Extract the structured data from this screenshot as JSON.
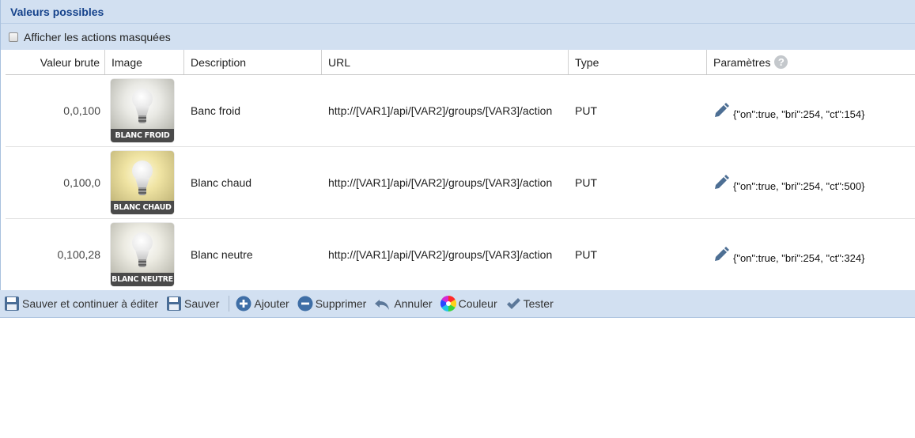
{
  "panel": {
    "title": "Valeurs possibles"
  },
  "options": {
    "show_hidden_label": "Afficher les actions masquées"
  },
  "table": {
    "headers": {
      "raw_value": "Valeur brute",
      "image": "Image",
      "description": "Description",
      "url": "URL",
      "type": "Type",
      "parameters": "Paramètres"
    },
    "rows": [
      {
        "raw_value": "0,0,100",
        "image_label": "BLANC FROID",
        "description": "Banc froid",
        "url": "http://[VAR1]/api/[VAR2]/groups/[VAR3]/action",
        "type": "PUT",
        "parameters": "{\"on\":true, \"bri\":254, \"ct\":154}"
      },
      {
        "raw_value": "0,100,0",
        "image_label": "BLANC CHAUD",
        "description": "Blanc chaud",
        "url": "http://[VAR1]/api/[VAR2]/groups/[VAR3]/action",
        "type": "PUT",
        "parameters": "{\"on\":true, \"bri\":254, \"ct\":500}"
      },
      {
        "raw_value": "0,100,28",
        "image_label": "BLANC NEUTRE",
        "description": "Blanc neutre",
        "url": "http://[VAR1]/api/[VAR2]/groups/[VAR3]/action",
        "type": "PUT",
        "parameters": "{\"on\":true, \"bri\":254, \"ct\":324}"
      }
    ]
  },
  "toolbar": {
    "save_continue": "Sauver et continuer à éditer",
    "save": "Sauver",
    "add": "Ajouter",
    "delete": "Supprimer",
    "cancel": "Annuler",
    "color": "Couleur",
    "test": "Tester"
  },
  "icons": {
    "help": "?",
    "checkbox": "checkbox-icon",
    "edit": "pencil-icon",
    "save": "floppy-icon",
    "add": "plus-circle-icon",
    "delete": "minus-circle-icon",
    "cancel": "undo-icon",
    "color": "color-wheel-icon",
    "test": "checkmark-icon"
  },
  "colors": {
    "panel_bg": "#d2e0f1",
    "title": "#15428b",
    "icon_blue": "#3e6ea6"
  }
}
